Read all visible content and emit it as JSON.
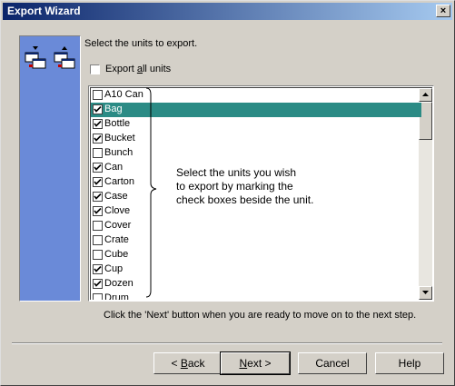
{
  "window": {
    "title": "Export Wizard",
    "close_label": "×"
  },
  "prompt": "Select the units to export.",
  "export_all": {
    "label": "Export all units",
    "checked": false
  },
  "units": [
    {
      "name": "A10 Can",
      "checked": false,
      "selected": false
    },
    {
      "name": "Bag",
      "checked": true,
      "selected": true
    },
    {
      "name": "Bottle",
      "checked": true,
      "selected": false
    },
    {
      "name": "Bucket",
      "checked": true,
      "selected": false
    },
    {
      "name": "Bunch",
      "checked": false,
      "selected": false
    },
    {
      "name": "Can",
      "checked": true,
      "selected": false
    },
    {
      "name": "Carton",
      "checked": true,
      "selected": false
    },
    {
      "name": "Case",
      "checked": true,
      "selected": false
    },
    {
      "name": "Clove",
      "checked": true,
      "selected": false
    },
    {
      "name": "Cover",
      "checked": false,
      "selected": false
    },
    {
      "name": "Crate",
      "checked": false,
      "selected": false
    },
    {
      "name": "Cube",
      "checked": false,
      "selected": false
    },
    {
      "name": "Cup",
      "checked": true,
      "selected": false
    },
    {
      "name": "Dozen",
      "checked": true,
      "selected": false
    },
    {
      "name": "Drum",
      "checked": false,
      "selected": false
    }
  ],
  "callout": {
    "lines": [
      "Select the units you wish",
      "to export by marking the",
      "check boxes beside the unit."
    ]
  },
  "hint": "Click the 'Next' button when you are ready to move on to the next step.",
  "buttons": {
    "back": "< Back",
    "next": "Next >",
    "cancel": "Cancel",
    "help": "Help"
  },
  "colors": {
    "selection": "#2b8b85",
    "side_panel": "#6a8ad8",
    "title_start": "#0a246a",
    "title_end": "#a6caf0"
  },
  "icons": {
    "side_left": "export-units-icon",
    "side_right": "import-units-icon"
  }
}
